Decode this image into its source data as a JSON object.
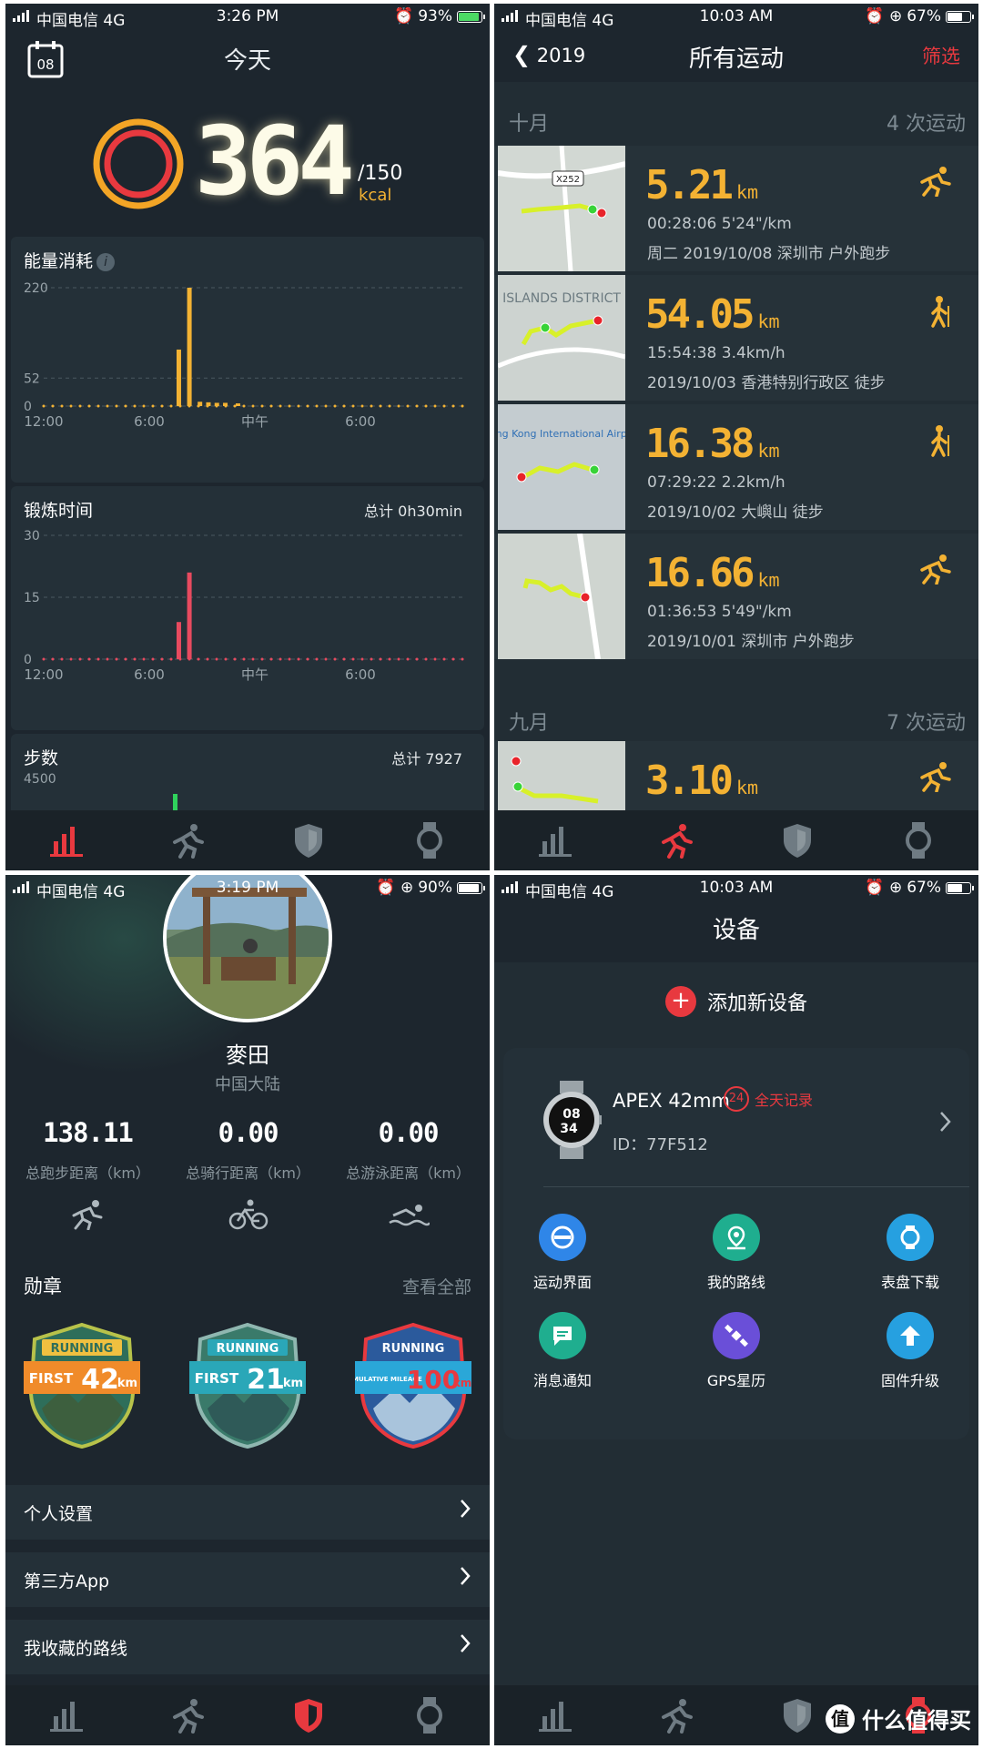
{
  "panel1": {
    "status": {
      "carrier": "中国电信 4G",
      "time": "3:26 PM",
      "battery": "93%",
      "battery_level": 0.93
    },
    "title": "今天",
    "calendar_day": "08",
    "calories": "364",
    "goal": "/150",
    "goal_unit": "kcal",
    "ring_colors": {
      "outer": "#f3a526",
      "inner": "#e8393f"
    },
    "energy": {
      "title": "能量消耗",
      "info": "i",
      "chart_data": {
        "type": "bar",
        "title": "能量消耗",
        "yticks": [
          "220",
          "52",
          "0"
        ],
        "xticks": [
          "12:00",
          "6:00",
          "中午",
          "6:00"
        ],
        "ylim": [
          0,
          220
        ],
        "bars": [
          {
            "x": 0.32,
            "value": 105
          },
          {
            "x": 0.345,
            "value": 220
          },
          {
            "x": 0.37,
            "value": 8
          },
          {
            "x": 0.39,
            "value": 7
          },
          {
            "x": 0.41,
            "value": 6
          },
          {
            "x": 0.43,
            "value": 6
          },
          {
            "x": 0.46,
            "value": 5
          }
        ],
        "color": "#f3b233"
      }
    },
    "exercise": {
      "title": "锻炼时间",
      "total": "总计  0h30min",
      "chart_data": {
        "type": "bar",
        "title": "锻炼时间",
        "yticks": [
          "30",
          "15",
          "0"
        ],
        "xticks": [
          "12:00",
          "6:00",
          "中午",
          "6:00"
        ],
        "ylim": [
          0,
          30
        ],
        "bars": [
          {
            "x": 0.32,
            "value": 9
          },
          {
            "x": 0.345,
            "value": 21
          }
        ],
        "color": "#e84a5f"
      }
    },
    "steps": {
      "title": "步数",
      "total": "总计  7927",
      "ytick": "4500"
    }
  },
  "panel2": {
    "status": {
      "carrier": "中国电信 4G",
      "time": "10:03 AM",
      "battery": "67%",
      "battery_level": 0.67
    },
    "back": "2019",
    "title": "所有运动",
    "filter": "筛选",
    "months": [
      {
        "name": "十月",
        "count": "4 次运动"
      },
      {
        "name": "九月",
        "count": "7 次运动"
      }
    ],
    "activities": [
      {
        "dist": "5.21",
        "unit": "km",
        "l2": "00:28:06   5'24\"/km",
        "l3": "周二 2019/10/08 深圳市 户外跑步",
        "type": "run",
        "map_label": "X252"
      },
      {
        "dist": "54.05",
        "unit": "km",
        "l2": "15:54:38   3.4km/h",
        "l3": "2019/10/03 香港特别行政区 徒步",
        "type": "hike",
        "map_label": "ISLANDS DISTRICT"
      },
      {
        "dist": "16.38",
        "unit": "km",
        "l2": "07:29:22   2.2km/h",
        "l3": "2019/10/02 大嶼山 徒步",
        "type": "hike",
        "map_label": "Hong Kong International Airport"
      },
      {
        "dist": "16.66",
        "unit": "km",
        "l2": "01:36:53   5'49\"/km",
        "l3": "2019/10/01 深圳市 户外跑步",
        "type": "run",
        "map_label": ""
      },
      {
        "dist": "3.10",
        "unit": "km",
        "l2": "",
        "l3": "",
        "type": "run",
        "map_label": ""
      }
    ]
  },
  "panel3": {
    "status": {
      "carrier": "中国电信 4G",
      "time": "3:19 PM",
      "battery": "90%",
      "battery_level": 0.9
    },
    "name": "麥田",
    "region": "中国大陆",
    "stats": [
      {
        "value": "138.11",
        "label": "总跑步距离（km）",
        "icon": "runner-icon"
      },
      {
        "value": "0.00",
        "label": "总骑行距离（km）",
        "icon": "cyclist-icon"
      },
      {
        "value": "0.00",
        "label": "总游泳距离（km）",
        "icon": "swimmer-icon"
      }
    ],
    "medals_title": "勋章",
    "medals_all": "查看全部",
    "medals": [
      {
        "top": "RUNNING",
        "sub": "FIRST",
        "km": "42",
        "unit": "km",
        "color": "#f08b2a",
        "shield": "#2e6e5a"
      },
      {
        "top": "RUNNING",
        "sub": "FIRST",
        "km": "21",
        "unit": "km",
        "color": "#2aa7b8",
        "shield": "#3a7a6a"
      },
      {
        "top": "RUNNING",
        "sub": "CUMULATIVE MILEAGE",
        "km": "100",
        "unit": "km",
        "color": "#e8393f",
        "shield": "#2b5a9c"
      }
    ],
    "rows": [
      "个人设置",
      "第三方App",
      "我收藏的路线"
    ]
  },
  "panel4": {
    "status": {
      "carrier": "中国电信 4G",
      "time": "10:03 AM",
      "battery": "67%",
      "battery_level": 0.67
    },
    "title": "设备",
    "add": "添加新设备",
    "device": {
      "name": "APEX 42mm",
      "badge": "24",
      "badge_text": "全天记录",
      "id": "ID：77F512",
      "watch_top": "08",
      "watch_bottom": "34"
    },
    "features": [
      {
        "label": "运动界面",
        "color": "#2f86e8"
      },
      {
        "label": "我的路线",
        "color": "#1fae8f"
      },
      {
        "label": "表盘下载",
        "color": "#26a0e0"
      },
      {
        "label": "消息通知",
        "color": "#1fae8f"
      },
      {
        "label": "GPS星历",
        "color": "#6a4fd8"
      },
      {
        "label": "固件升级",
        "color": "#26a0e0"
      }
    ],
    "watermark": "什么值得买",
    "watermark_logo": "值"
  }
}
